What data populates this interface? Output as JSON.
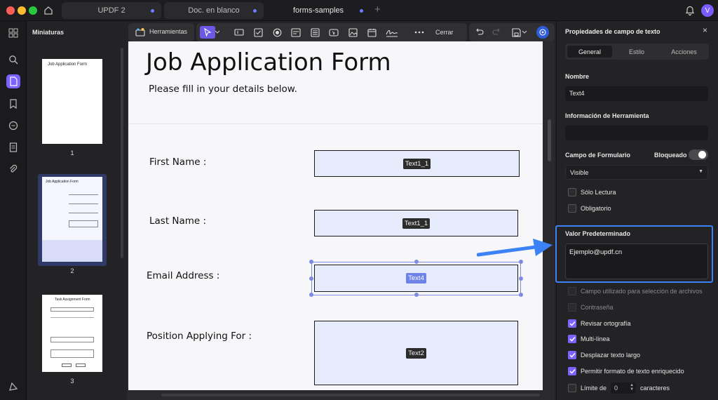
{
  "tabs": [
    {
      "label": "UPDF 2"
    },
    {
      "label": "Doc. en blanco"
    },
    {
      "label": "forms-samples"
    }
  ],
  "user": {
    "initial": "V"
  },
  "thumbnails": {
    "title": "Miniaturas",
    "pages": [
      {
        "num": "1",
        "heading": "Job Application Form"
      },
      {
        "num": "2",
        "heading": "Job Application Form"
      },
      {
        "num": "3",
        "heading": "Task Assignment Form"
      }
    ]
  },
  "toolbar": {
    "herramientas": "Herramientas",
    "cerrar": "Cerrar"
  },
  "document": {
    "title": "Job Application Form",
    "subtitle": "Please fill in your details below.",
    "fields": [
      {
        "label": "First Name :",
        "tag": "Text1_1"
      },
      {
        "label": "Last Name :",
        "tag": "Text1_1"
      },
      {
        "label": "Email Address :",
        "tag": "Text4"
      },
      {
        "label": "Position Applying For :",
        "tag": "Text2"
      }
    ]
  },
  "panel": {
    "title": "Propiedades de campo de texto",
    "tabs": [
      "General",
      "Estilo",
      "Acciones"
    ],
    "nombre_label": "Nombre",
    "nombre_value": "Text4",
    "info_label": "Información de Herramienta",
    "info_value": "",
    "campo_label": "Campo de Formulario",
    "bloqueado_label": "Bloqueado",
    "visibility_value": "Visible",
    "solo_lectura": "Sólo Lectura",
    "obligatorio": "Obligatorio",
    "valor_label": "Valor Predeterminado",
    "valor_value": "Ejemplo@updf.cn",
    "options": [
      {
        "label": "Campo utilizado para selección de archivos",
        "state": "disabled"
      },
      {
        "label": "Contraseña",
        "state": "disabled"
      },
      {
        "label": "Revisar ortografía",
        "state": "on"
      },
      {
        "label": "Multi-línea",
        "state": "on"
      },
      {
        "label": "Desplazar texto largo",
        "state": "on"
      },
      {
        "label": "Permitir formato de texto enriquecido",
        "state": "on"
      }
    ],
    "limit_label": "Límite de",
    "limit_value": "0",
    "limit_suffix": "caracteres"
  },
  "colors": {
    "accent": "#7a63ff",
    "highlight": "#3b82f6",
    "field_fill": "#e6ecfb"
  }
}
